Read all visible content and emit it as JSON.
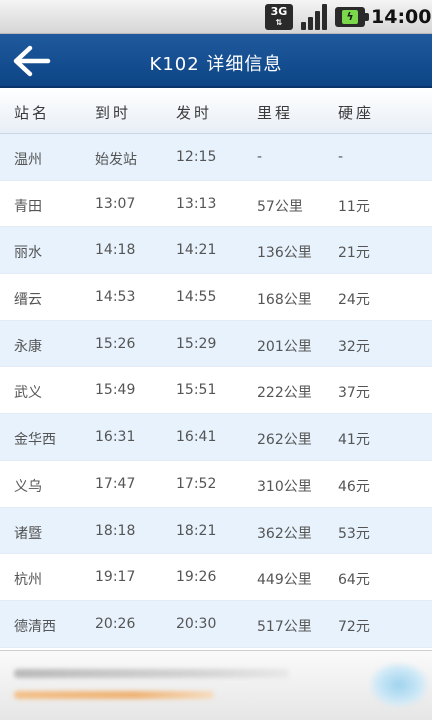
{
  "status_bar": {
    "network": "3G",
    "time": "14:00",
    "icons": [
      "3g-data-icon",
      "signal-strength-icon",
      "battery-charging-icon"
    ]
  },
  "header": {
    "back_icon": "arrow-left-icon",
    "title": "K102 详细信息"
  },
  "table": {
    "columns": [
      "站名",
      "到时",
      "发时",
      "里程",
      "硬座"
    ],
    "rows": [
      [
        "温州",
        "始发站",
        "12:15",
        "-",
        "-"
      ],
      [
        "青田",
        "13:07",
        "13:13",
        "57公里",
        "11元"
      ],
      [
        "丽水",
        "14:18",
        "14:21",
        "136公里",
        "21元"
      ],
      [
        "缙云",
        "14:53",
        "14:55",
        "168公里",
        "24元"
      ],
      [
        "永康",
        "15:26",
        "15:29",
        "201公里",
        "32元"
      ],
      [
        "武义",
        "15:49",
        "15:51",
        "222公里",
        "37元"
      ],
      [
        "金华西",
        "16:31",
        "16:41",
        "262公里",
        "41元"
      ],
      [
        "义乌",
        "17:47",
        "17:52",
        "310公里",
        "46元"
      ],
      [
        "诸暨",
        "18:18",
        "18:21",
        "362公里",
        "53元"
      ],
      [
        "杭州",
        "19:17",
        "19:26",
        "449公里",
        "64元"
      ],
      [
        "德清西",
        "20:26",
        "20:30",
        "517公里",
        "72元"
      ]
    ]
  },
  "colors": {
    "title_bar": "#0d4585",
    "row_alt": "#e7f2fc",
    "text": "#555555"
  }
}
